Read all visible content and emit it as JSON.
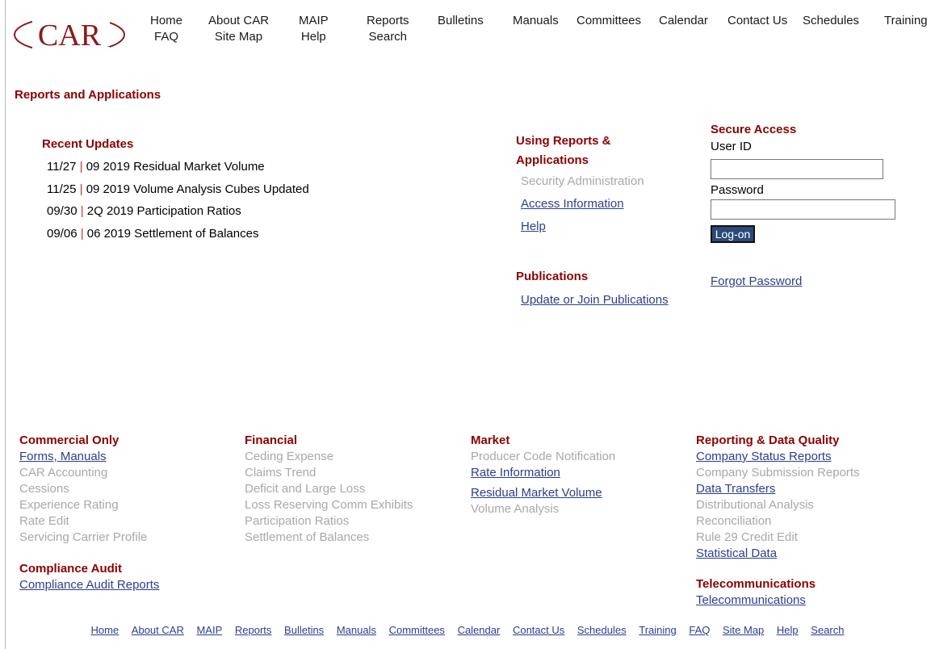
{
  "logo": {
    "text": "CAR"
  },
  "nav": [
    {
      "top": "Home",
      "bottom": "FAQ"
    },
    {
      "top": "About CAR",
      "bottom": "Site Map"
    },
    {
      "top": "MAIP",
      "bottom": "Help"
    },
    {
      "top": "Reports",
      "bottom": "Search"
    },
    {
      "top": "Bulletins",
      "bottom": ""
    },
    {
      "top": "Manuals",
      "bottom": ""
    },
    {
      "top": "Committees",
      "bottom": ""
    },
    {
      "top": "Calendar",
      "bottom": ""
    },
    {
      "top": "Contact Us",
      "bottom": ""
    },
    {
      "top": "Schedules",
      "bottom": ""
    },
    {
      "top": "Training",
      "bottom": ""
    }
  ],
  "page_heading": "Reports and Applications",
  "recent_updates": {
    "title": "Recent Updates",
    "items": [
      {
        "date": "11/27",
        "sep": "|",
        "text": "09 2019 Residual Market Volume"
      },
      {
        "date": "11/25",
        "sep": "|",
        "text": "09 2019 Volume Analysis Cubes Updated"
      },
      {
        "date": "09/30",
        "sep": "|",
        "text": "2Q 2019 Participation Ratios"
      },
      {
        "date": "09/06",
        "sep": "|",
        "text": "06 2019 Settlement of Balances"
      }
    ]
  },
  "using": {
    "title_line1": "Using Reports &",
    "title_line2": "Applications",
    "security_admin": "Security Administration",
    "access_info": "Access Information",
    "help": "Help"
  },
  "publications": {
    "title": "Publications",
    "link": "Update or Join Publications"
  },
  "secure": {
    "title": "Secure Access",
    "user_label": "User ID",
    "user_value": "",
    "password_label": "Password",
    "password_value": "",
    "logon": "Log-on",
    "forgot": "Forgot Password"
  },
  "columns": {
    "commercial": {
      "title": "Commercial Only",
      "items": [
        "Forms, Manuals",
        "CAR Accounting",
        "Cessions",
        "Experience Rating",
        "Rate Edit",
        "Servicing Carrier Profile"
      ]
    },
    "compliance": {
      "title": "Compliance Audit",
      "items": [
        "Compliance Audit Reports"
      ]
    },
    "financial": {
      "title": "Financial",
      "items": [
        "Ceding Expense",
        "Claims Trend",
        "Deficit and Large Loss",
        "Loss Reserving Comm Exhibits",
        "Participation Ratios",
        "Settlement of Balances"
      ]
    },
    "market": {
      "title": "Market",
      "items": [
        "Producer Code Notification",
        "Rate Information",
        "Residual Market Volume",
        "Volume Analysis"
      ]
    },
    "reporting": {
      "title": "Reporting & Data Quality",
      "items": [
        "Company Status Reports",
        "Company Submission Reports",
        "Data Transfers",
        "Distributional Analysis",
        "Reconciliation",
        "Rule 29 Credit Edit",
        "Statistical Data"
      ]
    },
    "telecom": {
      "title": "Telecommunications",
      "items": [
        "Telecommunications"
      ]
    }
  },
  "footer_nav": [
    "Home",
    "About CAR",
    "MAIP",
    "Reports",
    "Bulletins",
    "Manuals",
    "Committees",
    "Calendar",
    "Contact Us",
    "Schedules",
    "Training",
    "FAQ",
    "Site Map",
    "Help",
    "Search"
  ],
  "colors": {
    "brand": "#8b0000",
    "link": "#2b3e8f",
    "muted": "#a8a8a8",
    "button": "#2c4a78"
  }
}
